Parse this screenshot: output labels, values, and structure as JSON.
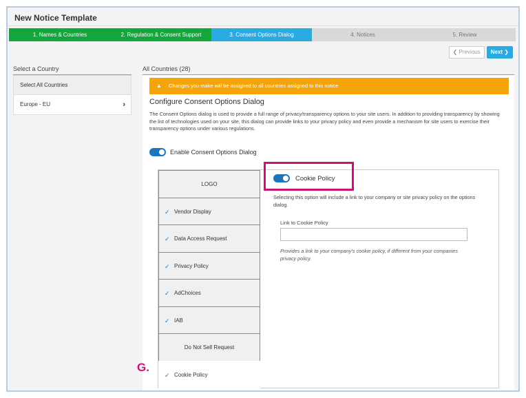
{
  "window": {
    "title": "New Notice Template"
  },
  "steps": [
    {
      "label": "1. Names & Countries",
      "state": "done"
    },
    {
      "label": "2. Regulation & Consent Support",
      "state": "done"
    },
    {
      "label": "3. Consent Options Dialog",
      "state": "active"
    },
    {
      "label": "4. Notices",
      "state": "todo"
    },
    {
      "label": "5. Review",
      "state": "todo"
    }
  ],
  "nav": {
    "previous_label": "Previous",
    "next_label": "Next"
  },
  "left": {
    "heading": "Select a Country",
    "items": [
      {
        "label": "Select All Countries"
      },
      {
        "label": "Europe - EU"
      }
    ]
  },
  "right": {
    "heading": "All Countries (28)",
    "warning": "Changes you make will be assigned to all countries assigned to this notice",
    "config_title": "Configure Consent Options Dialog",
    "config_description": "The Consent Options dialog is used to provide a full range of privacy/transparency options to your site users. In addition to providing transparency by showing the list of technologies used on your site, this dialog can provide links to your privacy policy and even provide a mechanism for site users to exercise their transparency options under various regulations.",
    "enable_label": "Enable Consent Options Dialog",
    "enable_on": true
  },
  "menu": [
    {
      "label": "LOGO",
      "checked": false
    },
    {
      "label": "Vendor Display",
      "checked": true
    },
    {
      "label": "Data Access Request",
      "checked": true
    },
    {
      "label": "Privacy Policy",
      "checked": true
    },
    {
      "label": "AdChoices",
      "checked": true
    },
    {
      "label": "IAB",
      "checked": true
    },
    {
      "label": "Do Not Sell Request",
      "checked": false
    },
    {
      "label": "Cookie Policy",
      "checked": true,
      "selected": true
    }
  ],
  "detail": {
    "toggle_label": "Cookie Policy",
    "toggle_on": true,
    "description": "Selecting this option will include a link to your company or site privacy policy on the options dialog.",
    "link_label": "Link to Cookie Policy",
    "link_value": "",
    "link_help": "Provides a link to your company's cookie policy, if different from your companies privacy policy."
  },
  "annotation": {
    "label": "G."
  },
  "colors": {
    "step_done": "#12a63c",
    "step_active": "#29abe2",
    "step_todo": "#d9d9d9",
    "warning": "#f6a40b",
    "toggle": "#1c75bc",
    "highlight": "#c8127b"
  },
  "icons": {
    "warning": "warning-triangle-icon",
    "chevron": "chevron-right-icon",
    "check": "check-icon"
  }
}
